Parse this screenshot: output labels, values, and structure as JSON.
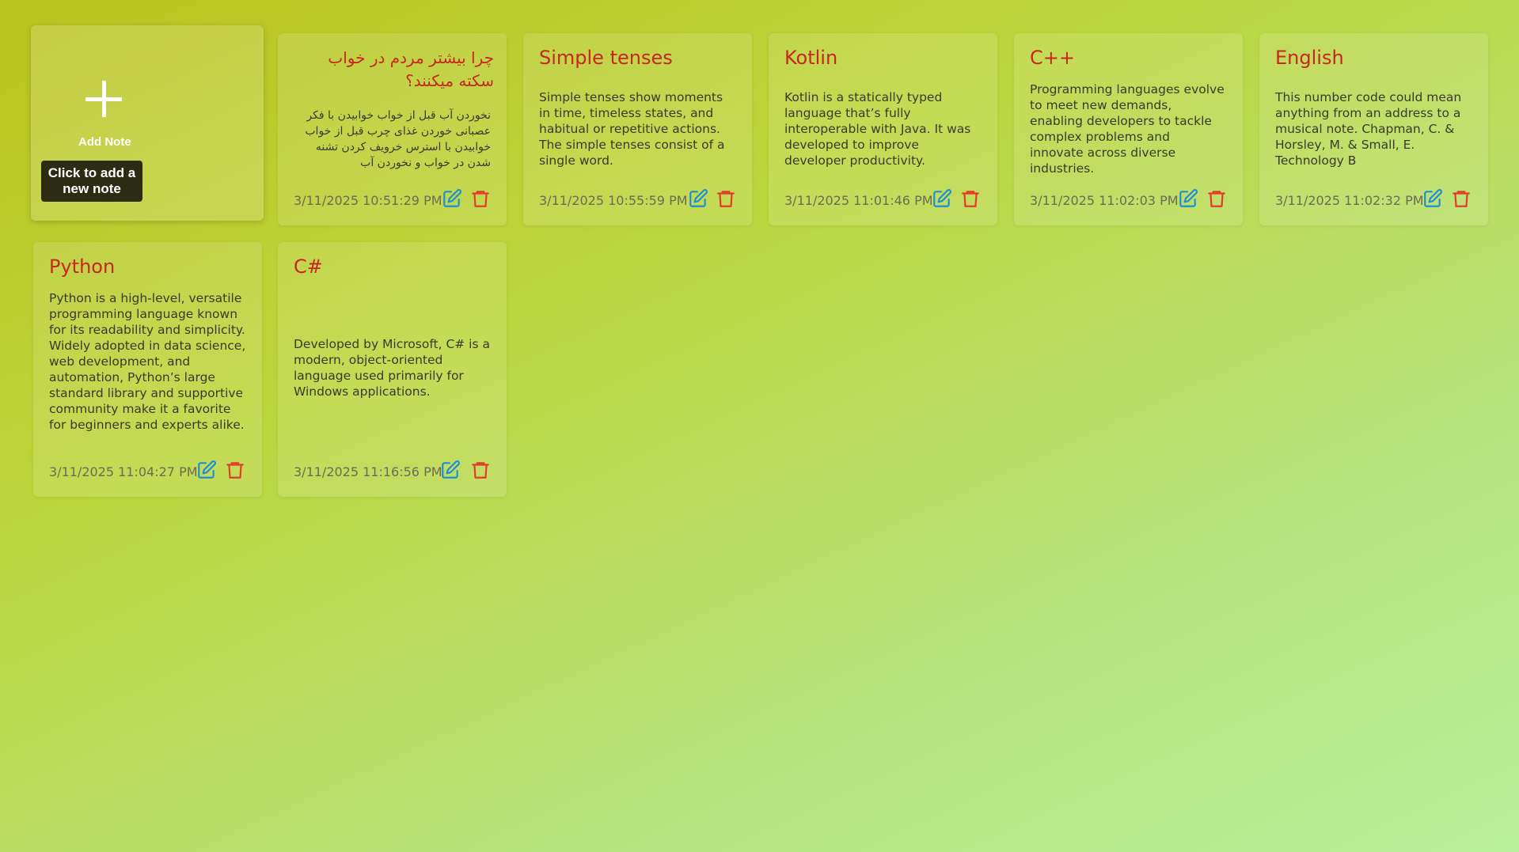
{
  "add_note": {
    "icon": "plus-icon",
    "label": "Add Note",
    "tooltip_line1": "Click to add a",
    "tooltip_line2": "new note"
  },
  "colors": {
    "title": "#c8261e",
    "edit_icon": "#1a8fd6",
    "delete_icon": "#e23b2a",
    "tooltip_bg": "#2c2c15"
  },
  "notes": [
    {
      "title": "چرا بیشتر مردم در خواب سکته میکنند؟",
      "body": "نخوردن آب قبل از خواب خوابیدن با فکر عصبانی خوردن غذای چرب قبل از خواب خوابیدن با استرس خرویف کردن تشنه شدن در خواب و نخوردن آب",
      "date": "3/11/2025 10:51:29 PM",
      "edit_icon": "edit-icon",
      "delete_icon": "trash-icon"
    },
    {
      "title": "Simple tenses",
      "body": "Simple tenses show moments in time, timeless states, and habitual or repetitive actions. The simple tenses consist of a single word.",
      "date": "3/11/2025 10:55:59 PM",
      "edit_icon": "edit-icon",
      "delete_icon": "trash-icon"
    },
    {
      "title": "Kotlin",
      "body": "Kotlin is a statically typed language that’s fully interoperable with Java. It was developed to improve developer productivity.",
      "date": "3/11/2025 11:01:46 PM",
      "edit_icon": "edit-icon",
      "delete_icon": "trash-icon"
    },
    {
      "title": "C++",
      "body": "Programming languages evolve to meet new demands, enabling developers to tackle complex problems and innovate across diverse industries.",
      "date": "3/11/2025 11:02:03 PM",
      "edit_icon": "edit-icon",
      "delete_icon": "trash-icon"
    },
    {
      "title": "English",
      "body": "This number code could mean anything from an address to a musical note. Chapman, C. & Horsley, M. & Small, E. Technology B",
      "date": "3/11/2025 11:02:32 PM",
      "edit_icon": "edit-icon",
      "delete_icon": "trash-icon"
    },
    {
      "title": "Python",
      "body": "Python is a high-level, versatile programming language known for its readability and simplicity. Widely adopted in data science, web development, and automation, Python’s large standard library and supportive community make it a favorite for beginners and experts alike.",
      "date": "3/11/2025 11:04:27 PM",
      "edit_icon": "edit-icon",
      "delete_icon": "trash-icon"
    },
    {
      "title": "C#",
      "body": "Developed by Microsoft, C# is a modern, object-oriented language used primarily for Windows applications.",
      "date": "3/11/2025 11:16:56 PM",
      "edit_icon": "edit-icon",
      "delete_icon": "trash-icon"
    }
  ]
}
